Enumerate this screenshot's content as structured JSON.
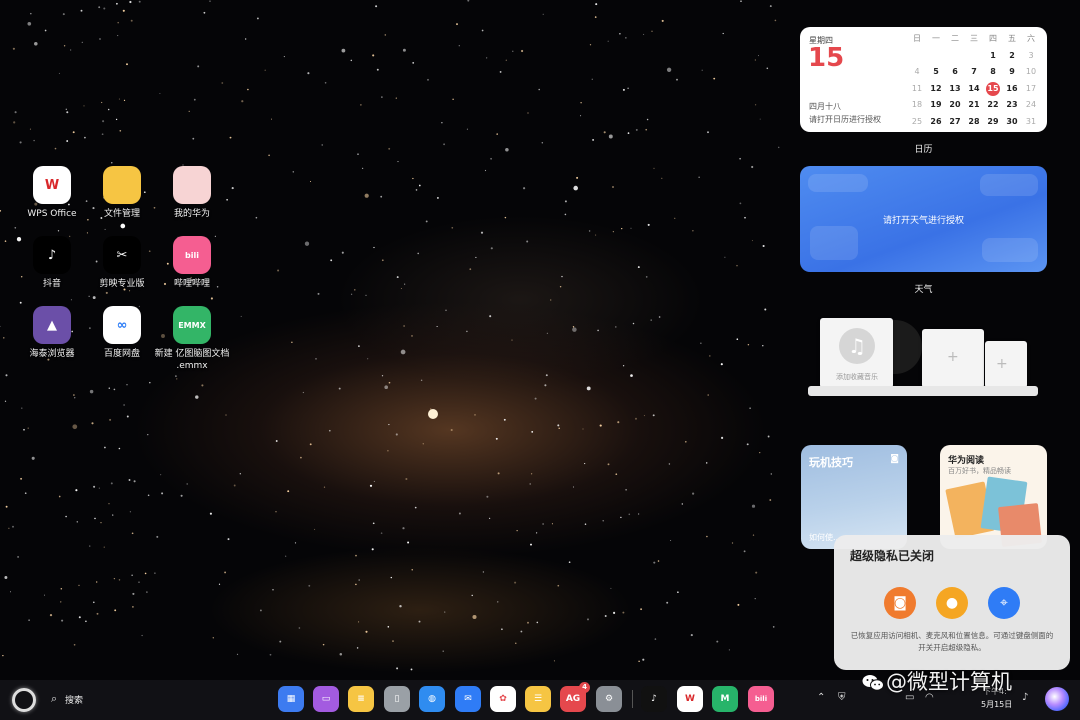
{
  "desktop_icons": [
    {
      "label": "WPS Office",
      "icon": "wps-office-icon",
      "glyph": "W",
      "color": "#ffffff",
      "fg": "#d9282b"
    },
    {
      "label": "文件管理",
      "icon": "folder-icon",
      "glyph": "",
      "color": "#f6c543",
      "fg": "#ffffff"
    },
    {
      "label": "我的华为",
      "icon": "my-huawei-icon",
      "glyph": "",
      "color": "#f7d4d4",
      "fg": "#e5484d"
    },
    {
      "label": "抖音",
      "icon": "douyin-icon",
      "glyph": "♪",
      "color": "#000000",
      "fg": "#ffffff"
    },
    {
      "label": "剪映专业版",
      "icon": "capcut-icon",
      "glyph": "✂",
      "color": "#000000",
      "fg": "#ffffff"
    },
    {
      "label": "哔哩哔哩",
      "icon": "bilibili-icon",
      "glyph": "bili",
      "color": "#f55e91",
      "fg": "#ffffff"
    },
    {
      "label": "海泰浏览器",
      "icon": "browser-icon",
      "glyph": "▲",
      "color": "#6b4fa8",
      "fg": "#ffffff"
    },
    {
      "label": "百度网盘",
      "icon": "baidu-netdisk-icon",
      "glyph": "∞",
      "color": "#ffffff",
      "fg": "#2b7cf6"
    },
    {
      "label": "新建 亿图脑图文档 .emmx",
      "icon": "emmx-file-icon",
      "glyph": "EMMX",
      "color": "#33b567",
      "fg": "#ffffff"
    }
  ],
  "calendar": {
    "weekday": "星期四",
    "day": "15",
    "lunar": "四月十八",
    "hint": "请打开日历进行授权",
    "headers": [
      "日",
      "一",
      "二",
      "三",
      "四",
      "五",
      "六"
    ],
    "weeks": [
      [
        "",
        "",
        "",
        "",
        "1",
        "2",
        "3"
      ],
      [
        "4",
        "5",
        "6",
        "7",
        "8",
        "9",
        "10"
      ],
      [
        "11",
        "12",
        "13",
        "14",
        "15",
        "16",
        "17"
      ],
      [
        "18",
        "19",
        "20",
        "21",
        "22",
        "23",
        "24"
      ],
      [
        "25",
        "26",
        "27",
        "28",
        "29",
        "30",
        "31"
      ]
    ],
    "today": "15",
    "caption": "日历"
  },
  "weather": {
    "message": "请打开天气进行授权",
    "caption": "天气"
  },
  "music": {
    "label": "添加收藏音乐"
  },
  "tips": {
    "title": "玩机技巧",
    "subtitle": "如何使..."
  },
  "reader": {
    "title": "华为阅读",
    "subtitle": "百万好书，精品畅读"
  },
  "privacy": {
    "title": "超级隐私已关闭",
    "description": "已恢复应用访问相机、麦克风和位置信息。可通过键盘侧面的开关开启超级隐私。",
    "buttons": [
      {
        "name": "camera",
        "icon": "camera-icon",
        "color": "#f07b2e"
      },
      {
        "name": "microphone",
        "icon": "microphone-icon",
        "color": "#f5a623"
      },
      {
        "name": "location",
        "icon": "location-icon",
        "color": "#2f7cf6"
      }
    ]
  },
  "taskbar": {
    "search_label": "搜索",
    "dock": [
      {
        "icon": "app-grid-icon",
        "color": "#3d7bf0",
        "glyph": "▦",
        "fg": "#ffffff"
      },
      {
        "icon": "multitask-icon",
        "color": "#a35be0",
        "glyph": "▭",
        "fg": "#ffffff"
      },
      {
        "icon": "notes-icon",
        "color": "#f6c543",
        "glyph": "≡",
        "fg": "#ffffff"
      },
      {
        "icon": "trash-icon",
        "color": "#9aa0a6",
        "glyph": "▯",
        "fg": "#ffffff"
      },
      {
        "icon": "browser-globe-icon",
        "color": "#2f8cf0",
        "glyph": "◍",
        "fg": "#ffffff"
      },
      {
        "icon": "mail-icon",
        "color": "#2f7cf6",
        "glyph": "✉",
        "fg": "#ffffff"
      },
      {
        "icon": "gallery-icon",
        "color": "#ffffff",
        "glyph": "✿",
        "fg": "#e5484d"
      },
      {
        "icon": "memo-icon",
        "color": "#f6c543",
        "glyph": "☰",
        "fg": "#ffffff"
      },
      {
        "icon": "app-gallery-icon",
        "color": "#e5484d",
        "glyph": "AG",
        "fg": "#ffffff",
        "badge": "4"
      },
      {
        "icon": "settings-icon",
        "color": "#8a8f96",
        "glyph": "⚙",
        "fg": "#ffffff"
      },
      {
        "icon": "douyin-icon",
        "color": "#111111",
        "glyph": "♪",
        "fg": "#ffffff"
      },
      {
        "icon": "wps-office-icon",
        "color": "#ffffff",
        "glyph": "W",
        "fg": "#d9282b"
      },
      {
        "icon": "mindmap-icon",
        "color": "#27b46a",
        "glyph": "M",
        "fg": "#ffffff"
      },
      {
        "icon": "bilibili-icon",
        "color": "#f55e91",
        "glyph": "bili",
        "fg": "#ffffff"
      }
    ],
    "time": "下午4:",
    "date": "5月15日"
  },
  "watermark": "@微型计算机"
}
